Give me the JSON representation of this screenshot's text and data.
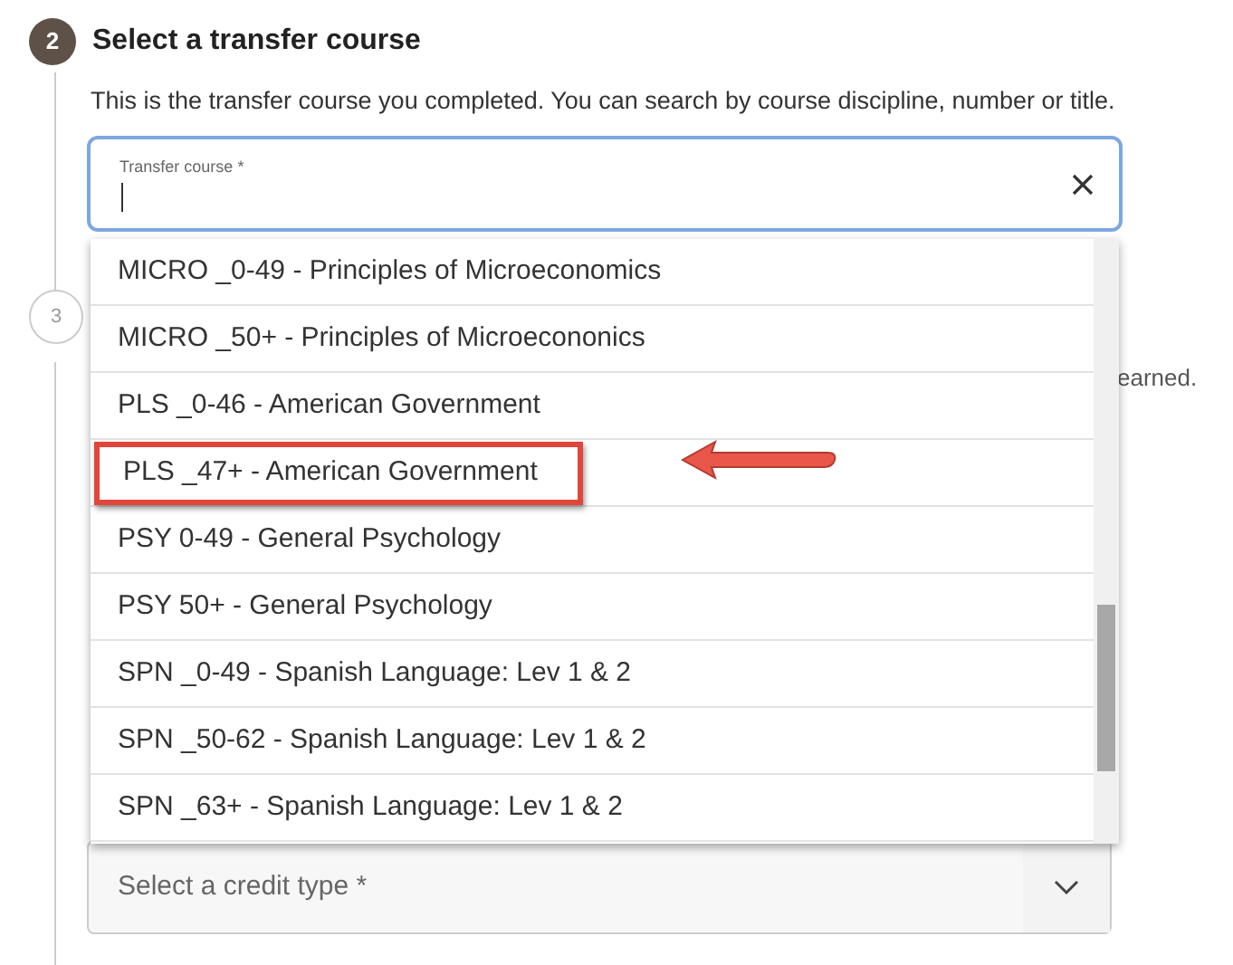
{
  "step_2": {
    "number": "2",
    "title": "Select a transfer course",
    "description": "This is the transfer course you completed. You can search by course discipline, number or title.",
    "field": {
      "label": "Transfer course *"
    },
    "options": [
      {
        "label": "MICRO _0-49 - Principles of Microeconomics",
        "annotated": false
      },
      {
        "label": "MICRO _50+ - Principles of Microecononics",
        "annotated": false
      },
      {
        "label": "PLS _0-46 - American Government",
        "annotated": false
      },
      {
        "label": "PLS _47+ - American Government",
        "annotated": true
      },
      {
        "label": "PSY 0-49 - General Psychology",
        "annotated": false
      },
      {
        "label": "PSY 50+ - General Psychology",
        "annotated": false
      },
      {
        "label": "SPN _0-49 - Spanish Language: Lev 1 & 2",
        "annotated": false
      },
      {
        "label": "SPN _50-62 - Spanish Language: Lev 1 & 2",
        "annotated": false
      },
      {
        "label": "SPN _63+ - Spanish Language: Lev 1 & 2",
        "annotated": false
      }
    ]
  },
  "step_3": {
    "number": "3",
    "text_fragment": "earned.",
    "credit_type": {
      "placeholder": "Select a credit type *"
    }
  }
}
